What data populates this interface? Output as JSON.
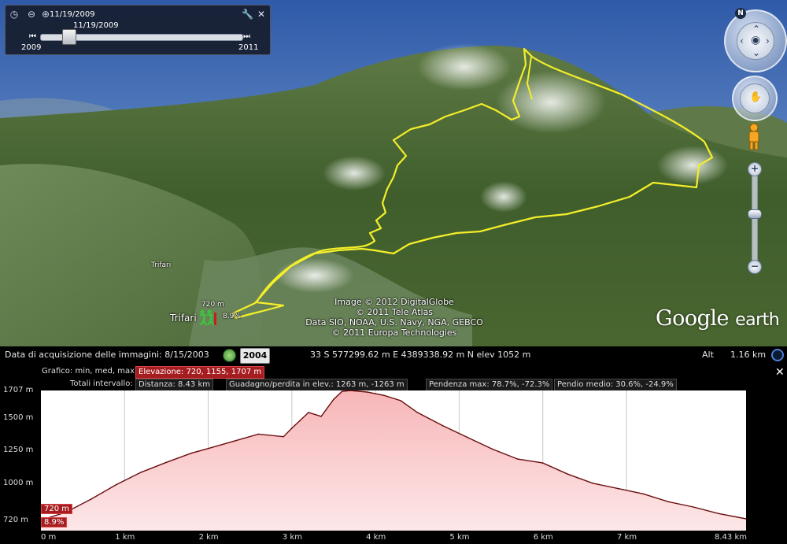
{
  "time_slider": {
    "top_date": "11/19/2009",
    "thumb_date": "11/19/2009",
    "start_year": "2009",
    "end_year": "2011"
  },
  "map": {
    "credits": [
      "Image © 2012 DigitalGlobe",
      "© 2011 Tele Atlas",
      "Data SIO, NOAA, U.S. Navy, NGA, GEBCO",
      "© 2011 Europa Technologies"
    ],
    "logo_google": "Google",
    "logo_earth": "earth",
    "place_small": "Trifari",
    "place_large": "Trifari",
    "hiker_elevation": "720 m",
    "hiker_grade": "8.9%",
    "compass_north": "N"
  },
  "status_bar": {
    "imagery_date": "Data di acquisizione delle immagini: 8/15/2003",
    "year_button": "2004",
    "coordinates": "33 S 577299.62 m E 4389338.92 m N elev  1052 m",
    "alt_label": "Alt",
    "alt_value": "1.16 km"
  },
  "profile_panel": {
    "graph_label": "Grafico: min, med, max:",
    "elevation_summary": "Elevazione: 720, 1155, 1707 m",
    "totals_label": "Totali intervallo:",
    "distance": "Distanza: 8.43 km",
    "gain_loss": "Guadagno/perdita in elev.: 1263 m, -1263 m",
    "max_slope": "Pendenza max: 78.7%, -72.3%",
    "avg_slope": "Pendio medio: 30.6%, -24.9%",
    "cursor_elevation": "720 m",
    "cursor_grade": "8.9%"
  },
  "chart_data": {
    "type": "area",
    "x_unit": "km",
    "y_unit": "m",
    "xlim": [
      0,
      8.43
    ],
    "ylim": [
      640,
      1707
    ],
    "y_ticks": [
      "1707 m",
      "1500 m",
      "1250 m",
      "1000 m",
      "720 m"
    ],
    "y_tick_values": [
      1707,
      1500,
      1250,
      1000,
      720
    ],
    "x_ticks": [
      "0 m",
      "1 km",
      "2 km",
      "3 km",
      "4 km",
      "5 km",
      "6 km",
      "7 km",
      "8.43 km"
    ],
    "x_tick_values": [
      0,
      1,
      2,
      3,
      4,
      5,
      6,
      7,
      8.43
    ],
    "x": [
      0,
      0.3,
      0.6,
      0.9,
      1.2,
      1.5,
      1.8,
      2.0,
      2.3,
      2.6,
      2.9,
      3.0,
      3.1,
      3.2,
      3.35,
      3.5,
      3.6,
      3.7,
      3.9,
      4.1,
      4.3,
      4.5,
      4.8,
      5.1,
      5.4,
      5.7,
      6.0,
      6.3,
      6.6,
      6.9,
      7.2,
      7.5,
      7.8,
      8.1,
      8.43
    ],
    "y": [
      720,
      780,
      880,
      990,
      1085,
      1160,
      1230,
      1265,
      1320,
      1375,
      1355,
      1420,
      1480,
      1540,
      1510,
      1640,
      1700,
      1707,
      1695,
      1670,
      1630,
      1540,
      1440,
      1350,
      1260,
      1185,
      1155,
      1070,
      1000,
      960,
      920,
      860,
      820,
      770,
      730
    ],
    "series": [
      {
        "color": "#6b0d0d",
        "fill": "#f7b6b8"
      }
    ],
    "grid": true
  }
}
